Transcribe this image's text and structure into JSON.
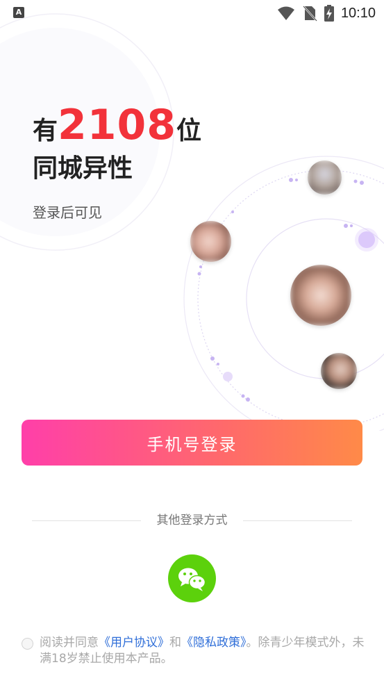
{
  "status_bar": {
    "time": "10:10",
    "icons": [
      "app-notification-icon",
      "wifi-icon",
      "no-sim-icon",
      "battery-charging-icon"
    ]
  },
  "headline": {
    "prefix": "有",
    "count": "2108",
    "suffix": "位",
    "line2": "同城异性",
    "subtitle": "登录后可见"
  },
  "login": {
    "phone_button": "手机号登录",
    "other_methods_label": "其他登录方式"
  },
  "agreement": {
    "text_before": "阅读并同意",
    "user_agreement_link": "《用户协议》",
    "and": "和",
    "privacy_link": "《隐私政策》",
    "text_after": "。除青少年模式外，未满18岁禁止使用本产品。",
    "checked": false
  },
  "colors": {
    "count_red": "#f2323a",
    "gradient_start": "#ff3fa9",
    "gradient_end": "#ff8a48",
    "wechat_green": "#5cd10c",
    "link_blue": "#2f6ed8"
  }
}
